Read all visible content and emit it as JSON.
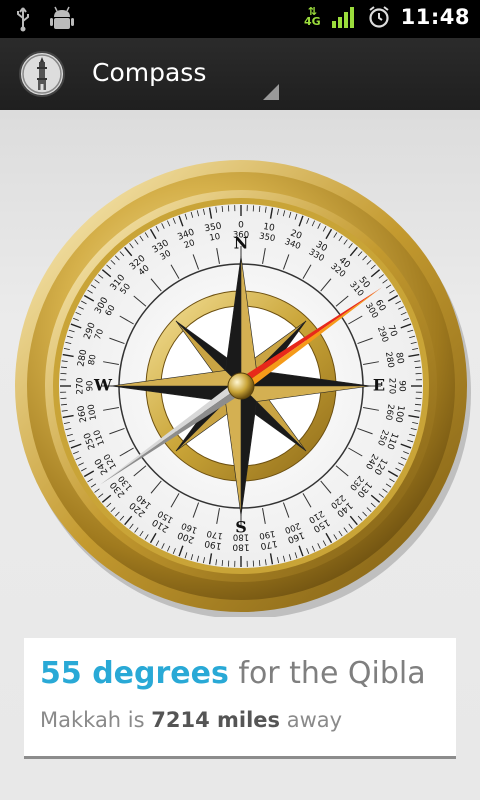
{
  "status_bar": {
    "time": "11:48",
    "network": "4G",
    "icons": [
      "usb-icon",
      "android-debug-icon",
      "signal-icon",
      "alarm-icon"
    ]
  },
  "action_bar": {
    "title": "Compass",
    "app_icon": "mosque-minaret-icon"
  },
  "compass": {
    "cardinals": [
      "N",
      "E",
      "S",
      "W"
    ],
    "outer_ticks": [
      "0",
      "10",
      "20",
      "30",
      "40",
      "50",
      "60",
      "70",
      "80",
      "90",
      "100",
      "110",
      "120",
      "130",
      "140",
      "150",
      "160",
      "170",
      "180",
      "190",
      "200",
      "210",
      "220",
      "230",
      "240",
      "250",
      "260",
      "270",
      "280",
      "290",
      "300",
      "310",
      "320",
      "330",
      "340",
      "350"
    ],
    "inner_ticks": [
      "360",
      "350",
      "340",
      "330",
      "320",
      "310",
      "300",
      "290",
      "280",
      "270",
      "260",
      "250",
      "240",
      "230",
      "220",
      "210",
      "200",
      "190",
      "180",
      "170",
      "160",
      "150",
      "140",
      "130",
      "120",
      "110",
      "100",
      "90",
      "80",
      "70",
      "60",
      "50",
      "40",
      "30",
      "20",
      "10"
    ],
    "needle_bearing_deg": 55
  },
  "qibla_card": {
    "degrees_text": "55 degrees",
    "qibla_text": " for the Qibla",
    "distance_prefix": "Makkah is ",
    "distance_value": "7214 miles",
    "distance_suffix": " away"
  },
  "colors": {
    "accent": "#29a9d6",
    "gold": "#c9a437",
    "needle_red": "#e8281a",
    "needle_orange": "#f59a19"
  }
}
